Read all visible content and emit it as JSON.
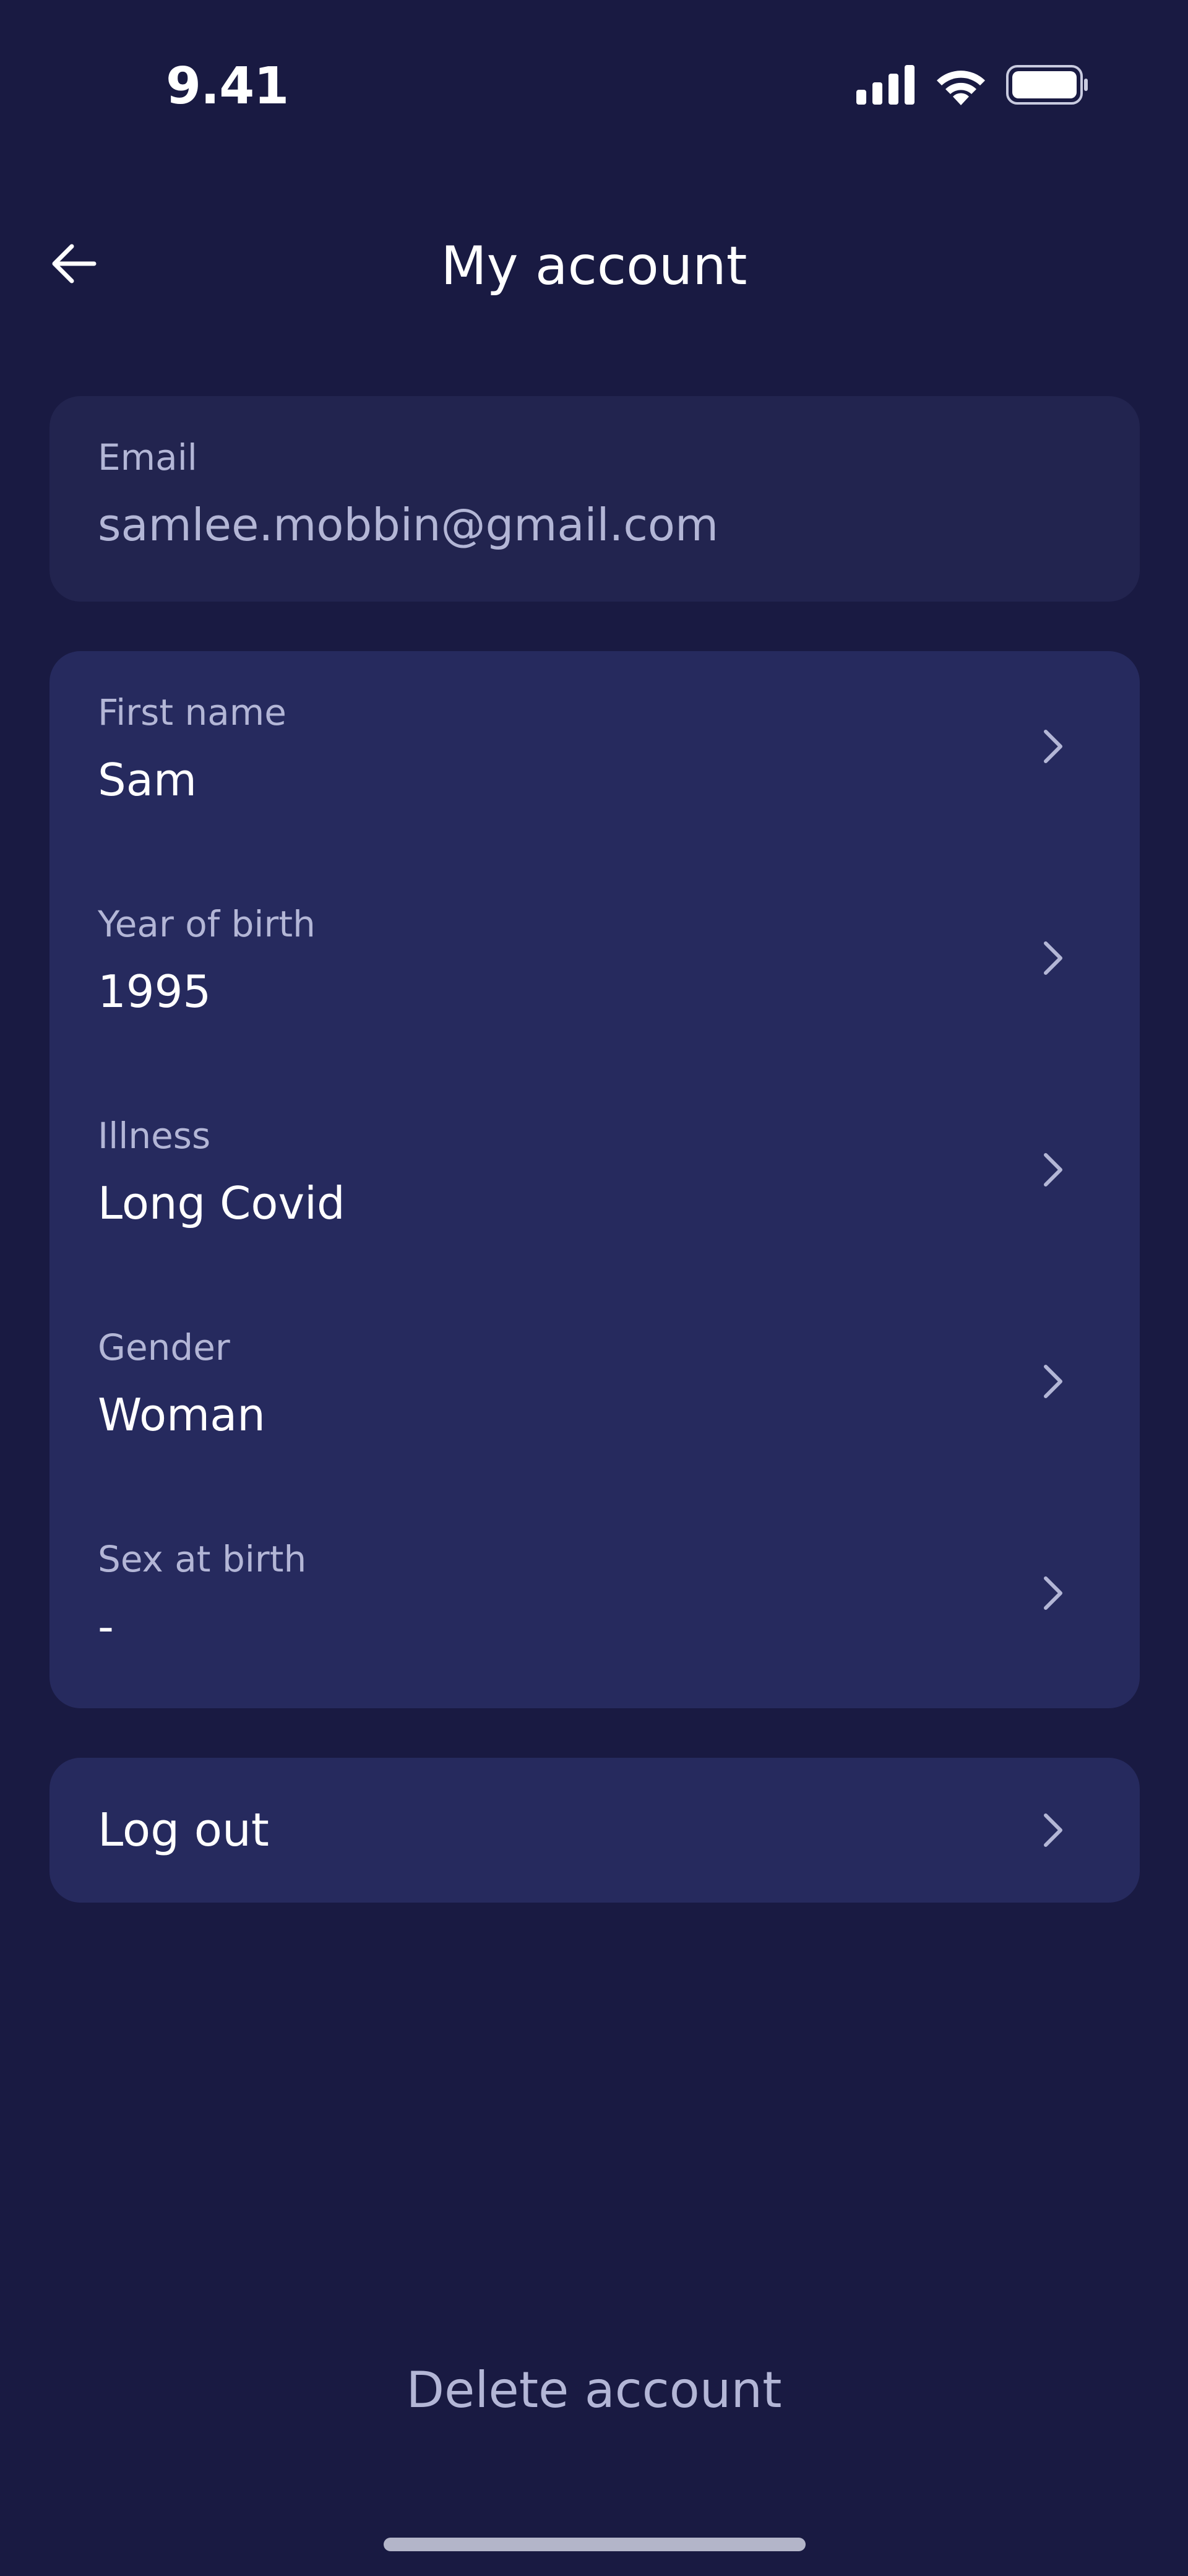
{
  "status_bar": {
    "time": "9.41"
  },
  "header": {
    "title": "My account",
    "back_icon": "arrow-left-icon"
  },
  "email": {
    "label": "Email",
    "value": "samlee.mobbin@gmail.com"
  },
  "details": [
    {
      "label": "First name",
      "value": "Sam"
    },
    {
      "label": "Year of birth",
      "value": "1995"
    },
    {
      "label": "Illness",
      "value": "Long Covid"
    },
    {
      "label": "Gender",
      "value": "Woman"
    },
    {
      "label": "Sex at birth",
      "value": "-"
    }
  ],
  "logout": {
    "label": "Log out"
  },
  "delete_account": {
    "label": "Delete account"
  },
  "colors": {
    "background": "#191a42",
    "card_dark": "#22244f",
    "card": "#262a5e",
    "muted_text": "#b3b6d6",
    "text": "#ffffff"
  }
}
